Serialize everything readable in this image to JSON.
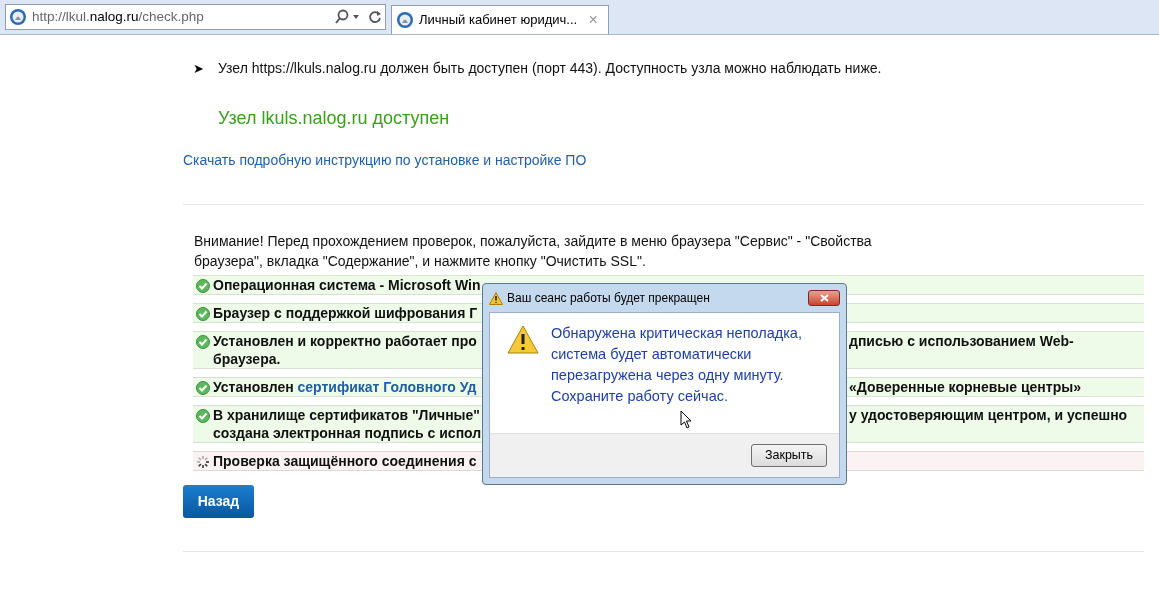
{
  "browser": {
    "address": {
      "prefix": "http://lkul.",
      "domain": "nalog.ru",
      "path": "/check.php"
    },
    "tab": {
      "title": "Личный кабинет юридич...",
      "close": "×",
      "selected": true
    }
  },
  "page": {
    "bullet": "➤",
    "requirement": "Узел https://lkuls.nalog.ru должен быть доступен (порт 443). Доступность узла можно наблюдать ниже.",
    "status": "Узел lkuls.nalog.ru доступен",
    "download_link": "Скачать подробную инструкцию по установке и настройке ПО",
    "notice": "Внимание! Перед прохождением проверок, пожалуйста, зайдите в меню браузера \"Сервис\" - \"Свойства браузера\", вкладка \"Содержание\", и нажмите кнопку \"Очистить SSL\".",
    "checks": [
      {
        "kind": "ok",
        "left": [
          "Операционная система - Microsoft Win"
        ]
      },
      {
        "kind": "ok",
        "left": [
          "Браузер с поддержкой шифрования Г"
        ]
      },
      {
        "kind": "ok",
        "left": [
          "Установлен и корректно работает про",
          "браузера."
        ],
        "right": [
          "дписью с использованием Web-"
        ]
      },
      {
        "kind": "ok",
        "left": [
          "Установлен "
        ],
        "link": "сертификат Головного Уд",
        "right": [
          "«Доверенные корневые центры»"
        ]
      },
      {
        "kind": "ok",
        "left": [
          "В хранилище сертификатов \"Личные\"",
          "создана электронная подпись с испол"
        ],
        "right": [
          "у удостоверяющим центром, и успешно"
        ]
      },
      {
        "kind": "loading",
        "left": [
          "Проверка защищённого соединения с"
        ]
      }
    ],
    "back_button": "Назад"
  },
  "dialog": {
    "title": "Ваш сеанс работы будет прекращен",
    "message": "Обнаружена критическая неполадка, система будет автоматически перезагружена через одну минуту. Сохраните работу сейчас.",
    "button": "Закрыть"
  }
}
